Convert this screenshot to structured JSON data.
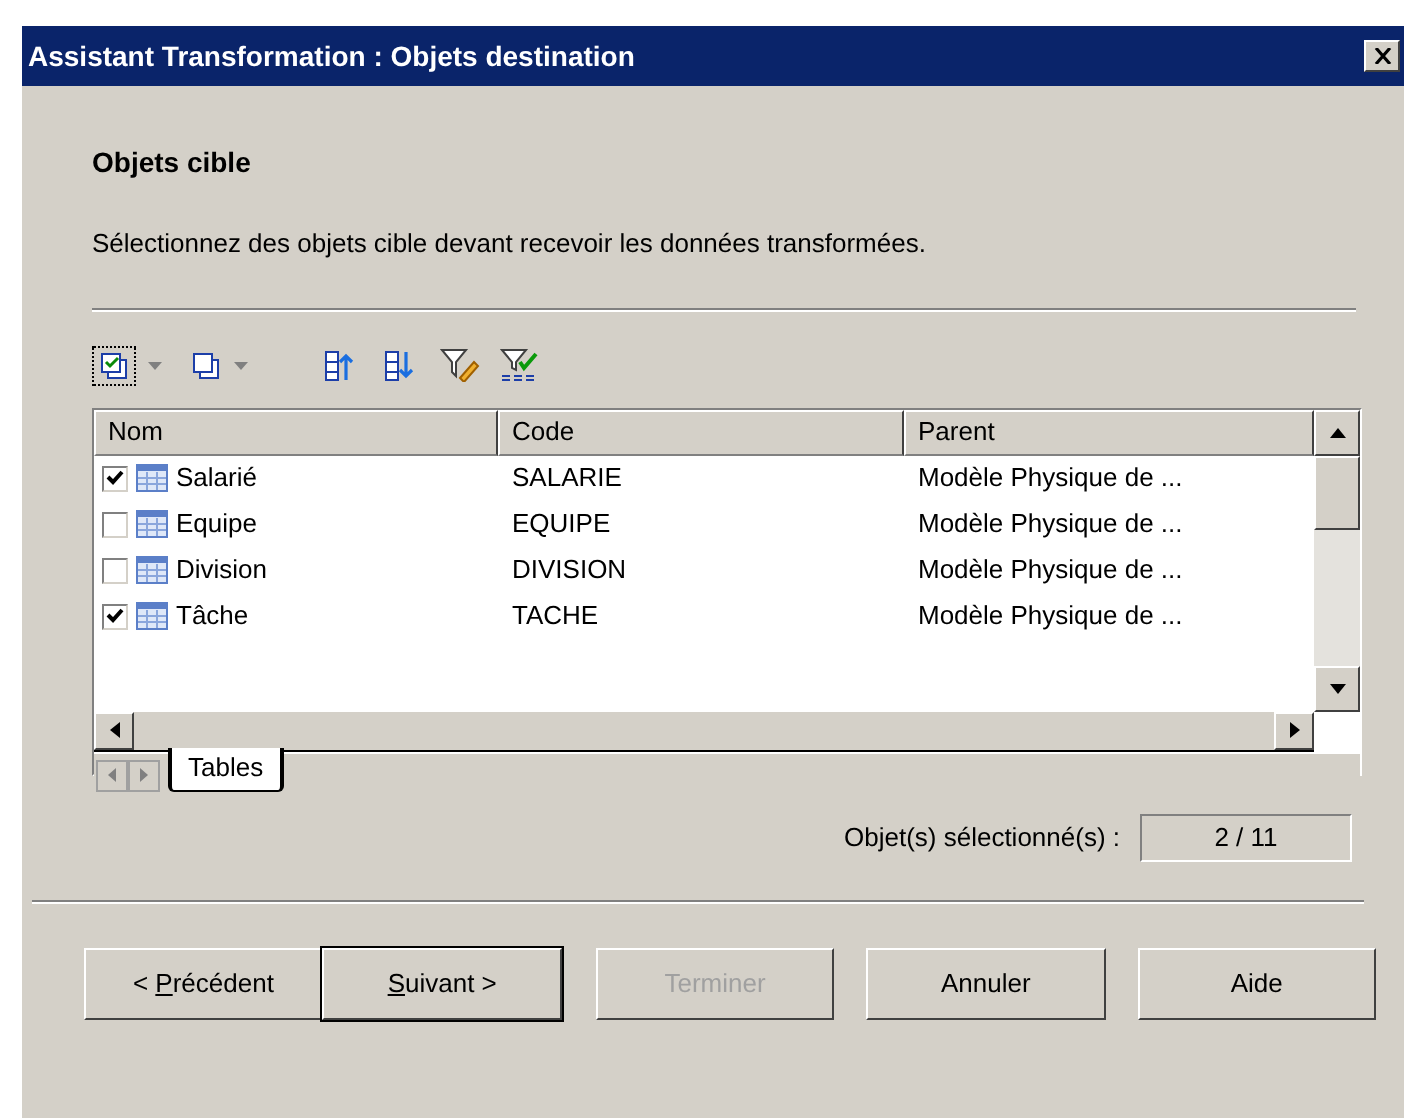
{
  "window": {
    "title": "Assistant Transformation : Objets destination"
  },
  "heading": "Objets cible",
  "description": "Sélectionnez des objets cible devant recevoir les données transformées.",
  "table": {
    "columns": [
      "Nom",
      "Code",
      "Parent"
    ],
    "rows": [
      {
        "name": "Salarié",
        "code": "SALARIE",
        "parent": "Modèle Physique de ...",
        "checked": true
      },
      {
        "name": "Equipe",
        "code": "EQUIPE",
        "parent": "Modèle Physique de ...",
        "checked": false
      },
      {
        "name": "Division",
        "code": "DIVISION",
        "parent": "Modèle Physique de ...",
        "checked": false
      },
      {
        "name": "Tâche",
        "code": "TACHE",
        "parent": "Modèle Physique de ...",
        "checked": true
      }
    ]
  },
  "tabs": [
    {
      "label": "Tables",
      "selected": true
    }
  ],
  "selection_count": {
    "label": "Objet(s) sélectionné(s) :",
    "value": "2 / 11"
  },
  "buttons": [
    {
      "label_prefix": "< ",
      "label_key": "P",
      "label_rest": "récédent",
      "disabled": false,
      "default": false
    },
    {
      "label_key": "S",
      "label_rest": "uivant >",
      "disabled": false,
      "default": true
    },
    {
      "label": "Terminer",
      "disabled": true,
      "default": false
    },
    {
      "label": "Annuler",
      "disabled": false,
      "default": false
    },
    {
      "label": "Aide",
      "disabled": false,
      "default": false
    }
  ]
}
